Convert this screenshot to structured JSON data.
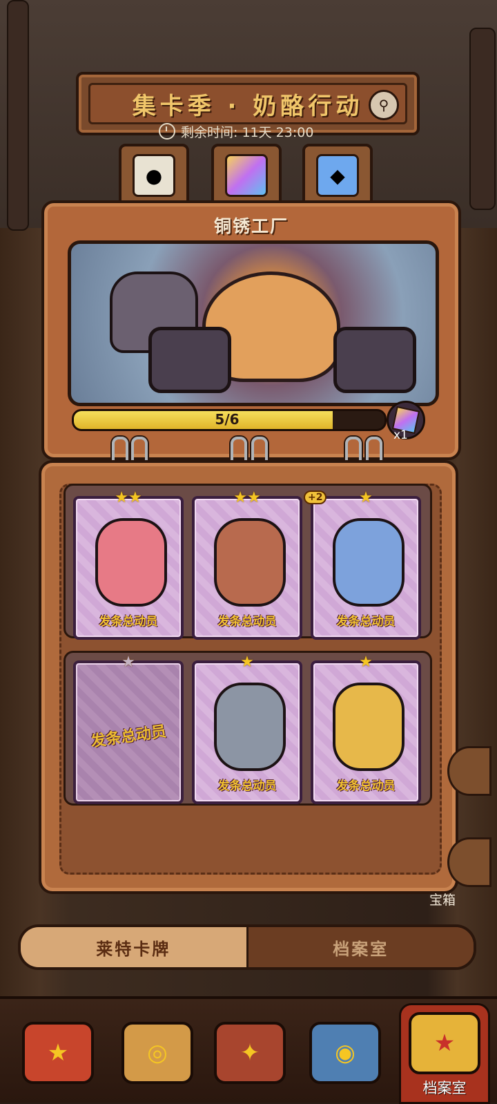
{
  "header": {
    "title": "集卡季 · 奶酪行动",
    "timer": "剩余时间: 11天 23:00"
  },
  "album": {
    "title": "铜锈工厂",
    "progress_text": "5/6",
    "progress_fraction": 0.833,
    "reward_count": "x1"
  },
  "cards": [
    {
      "stars": "★★",
      "label": "发条总动员",
      "plus": "",
      "empty": false,
      "art_color": "#e77a86"
    },
    {
      "stars": "★★",
      "label": "发条总动员",
      "plus": "",
      "empty": false,
      "art_color": "#b86a4e"
    },
    {
      "stars": "★",
      "label": "发条总动员",
      "plus": "+2",
      "empty": false,
      "art_color": "#7da2dc"
    },
    {
      "stars": "★",
      "label": "发条总动员",
      "plus": "",
      "empty": true,
      "art_color": ""
    },
    {
      "stars": "★",
      "label": "发条总动员",
      "plus": "",
      "empty": false,
      "art_color": "#8c95a4"
    },
    {
      "stars": "★",
      "label": "发条总动员",
      "plus": "",
      "empty": false,
      "art_color": "#e7b84a"
    }
  ],
  "side": {
    "chest_label": "宝箱"
  },
  "switch_tabs": {
    "left": "莱特卡牌",
    "right": "档案室"
  },
  "nav": {
    "active_label": "档案室"
  }
}
